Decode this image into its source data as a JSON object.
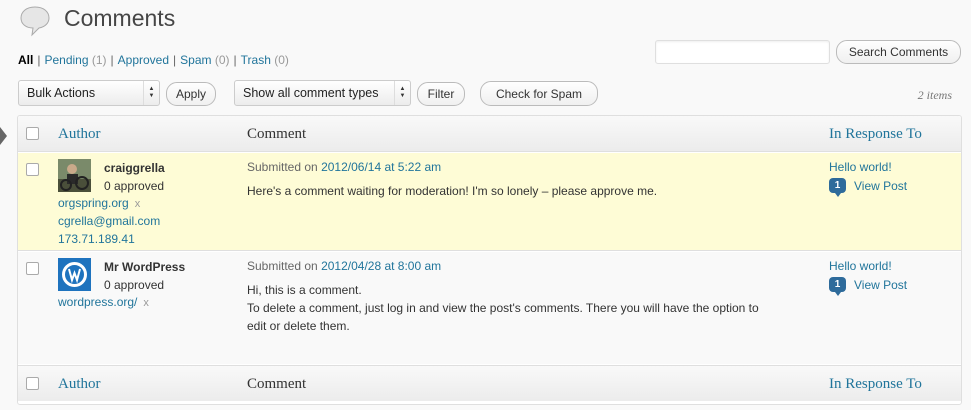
{
  "header": {
    "title": "Comments",
    "icon": "comments-icon"
  },
  "status_links": [
    {
      "label": "All",
      "count": ""
    },
    {
      "label": "Pending",
      "count": "(1)"
    },
    {
      "label": "Approved",
      "count": ""
    },
    {
      "label": "Spam",
      "count": "(0)"
    },
    {
      "label": "Trash",
      "count": "(0)"
    }
  ],
  "search": {
    "value": "",
    "button": "Search Comments"
  },
  "tablenav": {
    "bulk_action": "Bulk Actions",
    "apply": "Apply",
    "comment_type": "Show all comment types",
    "filter": "Filter",
    "check_spam": "Check for Spam",
    "items_count": "2 items"
  },
  "columns": {
    "author": "Author",
    "comment": "Comment",
    "response": "In Response To"
  },
  "comments": [
    {
      "author": "craiggrella",
      "approved": "0 approved",
      "url": "orgspring.org",
      "email": "cgrella@gmail.com",
      "ip": "173.71.189.41",
      "submitted_prefix": "Submitted on",
      "date": "2012/06/14 at 5:22 am",
      "text": [
        "Here's a comment waiting for moderation! I'm so lonely – please approve me."
      ],
      "post_title": "Hello world!",
      "post_comment_count": "1",
      "view_post": "View Post",
      "status": "pending"
    },
    {
      "author": "Mr WordPress",
      "approved": "0 approved",
      "url": "wordpress.org/",
      "submitted_prefix": "Submitted on",
      "date": "2012/04/28 at 8:00 am",
      "text": [
        "Hi, this is a comment.",
        "To delete a comment, just log in and view the post's comments. There you will have the option to",
        "edit or delete them."
      ],
      "post_title": "Hello world!",
      "post_comment_count": "1",
      "view_post": "View Post",
      "status": "approved"
    }
  ],
  "colors": {
    "link": "#21759b",
    "pending_bg": "#fefcd6",
    "bubble": "#2e6b9b"
  },
  "remove_glyph": "x"
}
